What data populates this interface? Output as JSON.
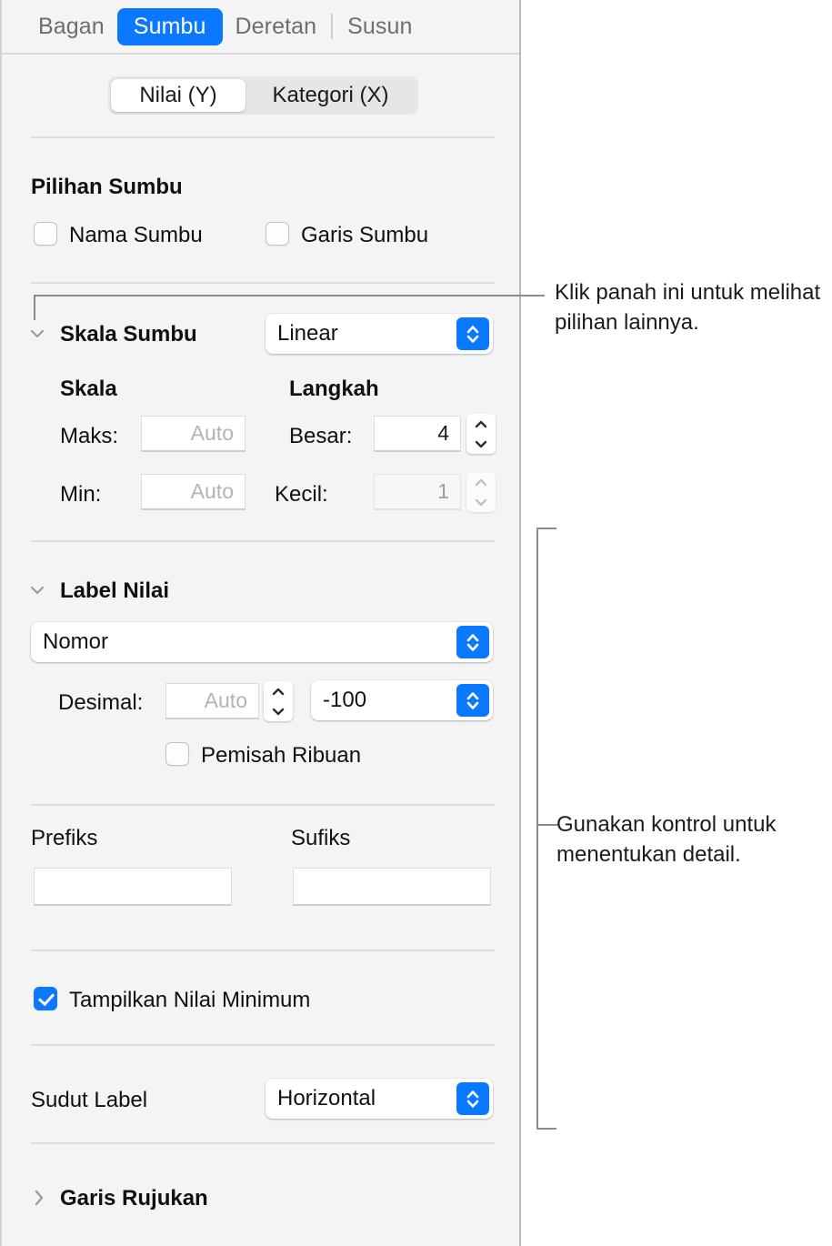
{
  "panel": {
    "tabs": [
      {
        "label": "Bagan",
        "active": false
      },
      {
        "label": "Sumbu",
        "active": true
      },
      {
        "label": "Deretan",
        "active": false
      },
      {
        "label": "Susun",
        "active": false
      }
    ],
    "segmented": {
      "options": [
        "Nilai (Y)",
        "Kategori (X)"
      ],
      "selected": "Nilai (Y)"
    },
    "axis_options": {
      "title": "Pilihan Sumbu",
      "checkboxes": [
        {
          "label": "Nama Sumbu",
          "checked": false
        },
        {
          "label": "Garis Sumbu",
          "checked": false
        }
      ]
    },
    "axis_scale": {
      "title": "Skala Sumbu",
      "expanded": true,
      "scale_type": "Linear",
      "col_scale_header": "Skala",
      "col_step_header": "Langkah",
      "rows": [
        {
          "label": "Maks:",
          "value": "Auto",
          "placeholder": true,
          "disabled": false
        },
        {
          "label": "Min:",
          "value": "Auto",
          "placeholder": true,
          "disabled": false
        }
      ],
      "step_rows": [
        {
          "label": "Besar:",
          "value": "4",
          "placeholder": false,
          "disabled": false
        },
        {
          "label": "Kecil:",
          "value": "1",
          "placeholder": false,
          "disabled": true
        }
      ]
    },
    "value_labels": {
      "title": "Label Nilai",
      "expanded": true,
      "format": "Nomor",
      "decimal_label": "Desimal:",
      "decimal_value": "Auto",
      "negative_style": "-100",
      "thousands_separator": {
        "label": "Pemisah Ribuan",
        "checked": false
      },
      "prefix_label": "Prefiks",
      "prefix_value": "",
      "suffix_label": "Sufiks",
      "suffix_value": "",
      "show_min": {
        "label": "Tampilkan Nilai Minimum",
        "checked": true
      },
      "label_angle_label": "Sudut Label",
      "label_angle_value": "Horizontal"
    },
    "reference_lines": {
      "title": "Garis Rujukan",
      "expanded": false
    }
  },
  "callouts": [
    {
      "id": "callout-disclosure",
      "text": "Klik panah ini untuk melihat pilihan lainnya."
    },
    {
      "id": "callout-controls",
      "text": "Gunakan kontrol untuk menentukan detail."
    }
  ],
  "colors": {
    "accent": "#0a78ff",
    "panel_bg": "#f4f4f4",
    "separator": "#dededd",
    "leader": "#8c8c8c"
  }
}
